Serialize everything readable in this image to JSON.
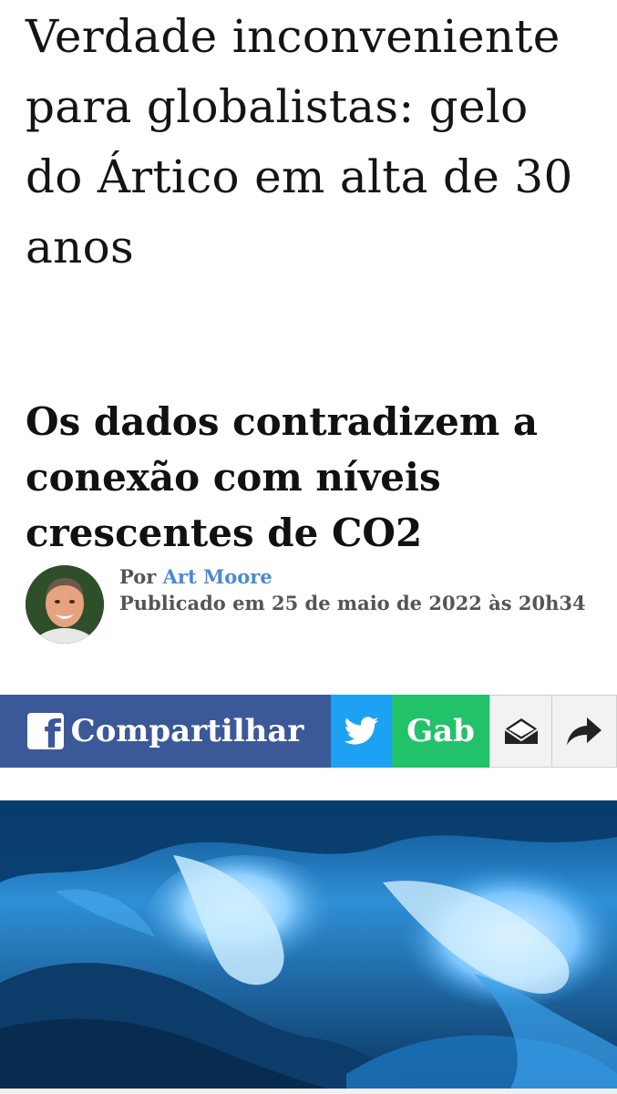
{
  "article": {
    "headline": "Verdade inconveniente para globalistas: gelo do Ártico em alta de 30 anos",
    "subheadline": "Os dados contradizem a conexão com níveis crescentes de CO2"
  },
  "byline": {
    "by_prefix": "Por",
    "author": "Art Moore",
    "published": "Publicado em 25 de maio de 2022 às 20h34"
  },
  "share_bar": {
    "facebook_label": "Compartilhar",
    "gab_label": "Gab",
    "icons": [
      "facebook-icon",
      "twitter-icon",
      "email-icon",
      "share-arrow-icon"
    ]
  },
  "hero_image": {
    "subject": "ice cave",
    "icon": "image"
  },
  "colors": {
    "facebook": "#3b5998",
    "twitter": "#1da1f2",
    "gab": "#21c26a",
    "link": "#4a8ad4"
  }
}
